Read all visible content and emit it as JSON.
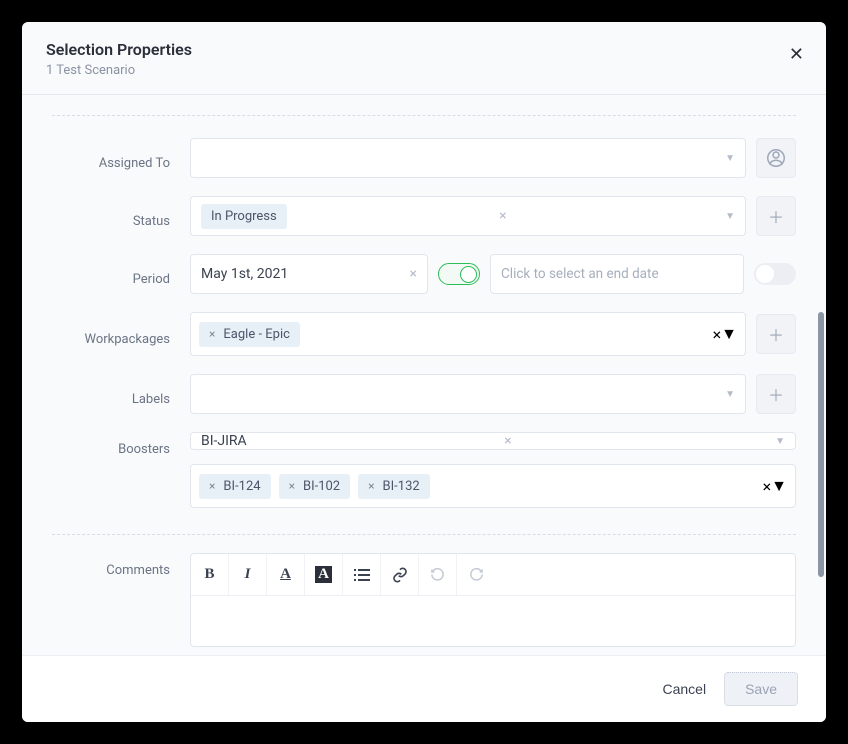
{
  "header": {
    "title": "Selection Properties",
    "subtitle": "1 Test Scenario"
  },
  "labels": {
    "assignedTo": "Assigned To",
    "status": "Status",
    "period": "Period",
    "workpackages": "Workpackages",
    "labels": "Labels",
    "boosters": "Boosters",
    "comments": "Comments"
  },
  "status": {
    "value": "In Progress"
  },
  "period": {
    "start": "May 1st, 2021",
    "endPlaceholder": "Click to select an end date"
  },
  "workpackages": {
    "items": [
      "Eagle - Epic"
    ]
  },
  "boosters": {
    "integration": "BI-JIRA",
    "issues": [
      "BI-124",
      "BI-102",
      "BI-132"
    ]
  },
  "footer": {
    "cancel": "Cancel",
    "save": "Save"
  }
}
